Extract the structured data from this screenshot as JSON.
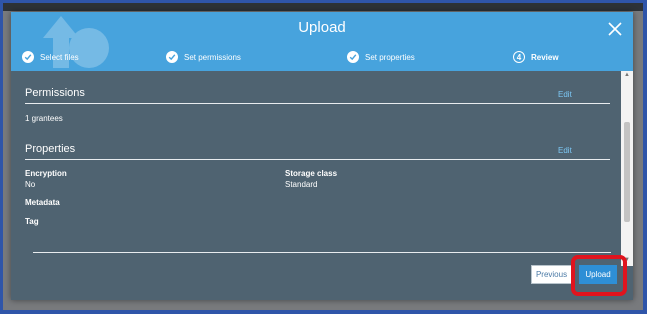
{
  "modal": {
    "title": "Upload",
    "steps": [
      {
        "label": "Select files",
        "marker": "✓",
        "state": "done"
      },
      {
        "label": "Set permissions",
        "marker": "✓",
        "state": "done"
      },
      {
        "label": "Set properties",
        "marker": "✓",
        "state": "done"
      },
      {
        "label": "Review",
        "marker": "4",
        "state": "active"
      }
    ],
    "permissions": {
      "title": "Permissions",
      "edit_label": "Edit",
      "grantees": "1 grantees"
    },
    "properties": {
      "title": "Properties",
      "edit_label": "Edit",
      "encryption_label": "Encryption",
      "encryption_value": "No",
      "storage_class_label": "Storage class",
      "storage_class_value": "Standard",
      "metadata_label": "Metadata",
      "tag_label": "Tag"
    },
    "buttons": {
      "previous": "Previous",
      "upload": "Upload"
    }
  },
  "colors": {
    "header": "#47a3dd",
    "body": "#4f6371",
    "primary_button": "#2e8fd6",
    "link": "#7cc8f5",
    "highlight": "#e0141e",
    "frame": "#2f55a9"
  },
  "icons": {
    "close": "close-icon",
    "step_done": "check-circle-icon",
    "watermark": "cloud-upload-icon"
  }
}
